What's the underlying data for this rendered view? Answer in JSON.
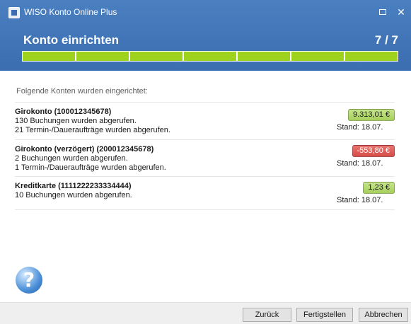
{
  "window": {
    "title": "WISO Konto Online Plus",
    "maximize_icon": "maximize-icon",
    "close_symbol": "✕"
  },
  "wizard": {
    "title": "Konto einrichten",
    "step": "7 / 7",
    "progress": {
      "completed": 7,
      "total": 7
    },
    "progress_color": "#9ed21c"
  },
  "intro": "Folgende Konten wurden eingerichtet:",
  "accounts": [
    {
      "name": "Girokonto (100012345678)",
      "lines": [
        "130 Buchungen wurden abgerufen.",
        "21  Termin-/Daueraufträge wurden abgerufen."
      ],
      "amount": "9.313,01 €",
      "status": "positive",
      "stand": "Stand: 18.07."
    },
    {
      "name": "Girokonto (verzögert) (200012345678)",
      "lines": [
        "2 Buchungen wurden abgerufen.",
        "1  Termin-/Daueraufträge wurden abgerufen."
      ],
      "amount": "-553,80 €",
      "status": "negative",
      "stand": "Stand: 18.07."
    },
    {
      "name": "Kreditkarte (1111222233334444)",
      "lines": [
        "10 Buchungen wurden abgerufen."
      ],
      "amount": "1,23 €",
      "status": "positive",
      "stand": "Stand: 18.07."
    }
  ],
  "help": {
    "icon": "help-icon",
    "glyph": "?"
  },
  "buttons": {
    "back": "Zurück",
    "finish": "Fertigstellen",
    "cancel": "Abbrechen"
  },
  "colors": {
    "header": "#3b6db0",
    "positive": "#a6cf5a",
    "negative": "#d84c48"
  }
}
